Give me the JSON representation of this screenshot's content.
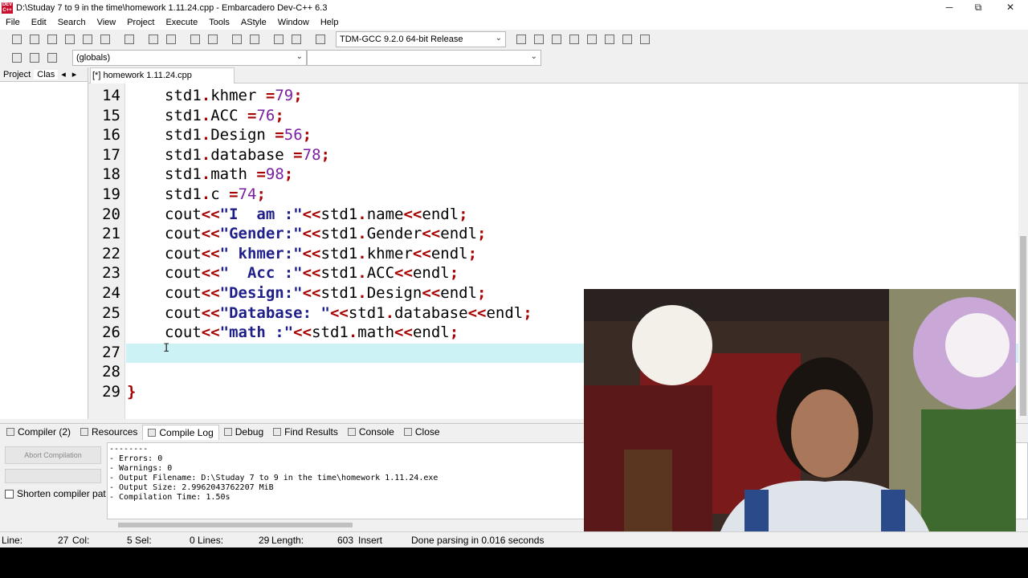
{
  "window": {
    "title": "D:\\Studay 7 to 9 in the time\\homework 1.11.24.cpp - Embarcadero Dev-C++ 6.3",
    "icon_text": "DEV C++",
    "minimize": "─",
    "maximize": "⧉",
    "close": "✕"
  },
  "menu": [
    "File",
    "Edit",
    "Search",
    "View",
    "Project",
    "Execute",
    "Tools",
    "AStyle",
    "Window",
    "Help"
  ],
  "toolbar": {
    "compiler": "TDM-GCC 9.2.0 64-bit Release",
    "icons": [
      "new-file-icon",
      "open-icon",
      "save-icon",
      "save-all-icon",
      "close-file-icon",
      "close-all-icon",
      "print-icon",
      "find-icon",
      "replace-icon",
      "goto-line-icon",
      "toggle-bookmark-icon",
      "undo-icon",
      "redo-icon",
      "indent-icon",
      "unindent-icon",
      "toggle-comment-icon",
      "new-project-icon",
      "project-options-icon",
      "class-browser-icon",
      "insert-icon",
      "compile-icon",
      "stop-icon",
      "chart-icon",
      "debug-icon"
    ]
  },
  "toolbar2": {
    "globals": "(globals)",
    "func": ""
  },
  "side_panel": {
    "tab_project": "Project",
    "tab_classes": "Clas",
    "prev": "◂",
    "next": "▸"
  },
  "editor": {
    "tab_label": "[*] homework 1.11.24.cpp",
    "lines": [
      {
        "num": "14",
        "code": [
          [
            "id",
            "std1"
          ],
          [
            "op",
            "."
          ],
          [
            "id",
            "khmer "
          ],
          [
            "op",
            "="
          ],
          [
            "num",
            "79"
          ],
          [
            "op",
            ";"
          ]
        ]
      },
      {
        "num": "15",
        "code": [
          [
            "id",
            "std1"
          ],
          [
            "op",
            "."
          ],
          [
            "id",
            "ACC "
          ],
          [
            "op",
            "="
          ],
          [
            "num",
            "76"
          ],
          [
            "op",
            ";"
          ]
        ]
      },
      {
        "num": "16",
        "code": [
          [
            "id",
            "std1"
          ],
          [
            "op",
            "."
          ],
          [
            "id",
            "Design "
          ],
          [
            "op",
            "="
          ],
          [
            "num",
            "56"
          ],
          [
            "op",
            ";"
          ]
        ]
      },
      {
        "num": "17",
        "code": [
          [
            "id",
            "std1"
          ],
          [
            "op",
            "."
          ],
          [
            "id",
            "database "
          ],
          [
            "op",
            "="
          ],
          [
            "num",
            "78"
          ],
          [
            "op",
            ";"
          ]
        ]
      },
      {
        "num": "18",
        "code": [
          [
            "id",
            "std1"
          ],
          [
            "op",
            "."
          ],
          [
            "id",
            "math "
          ],
          [
            "op",
            "="
          ],
          [
            "num",
            "98"
          ],
          [
            "op",
            ";"
          ]
        ]
      },
      {
        "num": "19",
        "code": [
          [
            "id",
            "std1"
          ],
          [
            "op",
            "."
          ],
          [
            "id",
            "c "
          ],
          [
            "op",
            "="
          ],
          [
            "num",
            "74"
          ],
          [
            "op",
            ";"
          ]
        ]
      },
      {
        "num": "20",
        "code": [
          [
            "id",
            "cout"
          ],
          [
            "op",
            "<<"
          ],
          [
            "str",
            "\"I  am :\""
          ],
          [
            "op",
            "<<"
          ],
          [
            "id",
            "std1"
          ],
          [
            "op",
            "."
          ],
          [
            "id",
            "name"
          ],
          [
            "op",
            "<<"
          ],
          [
            "id",
            "endl"
          ],
          [
            "op",
            ";"
          ]
        ]
      },
      {
        "num": "21",
        "code": [
          [
            "id",
            "cout"
          ],
          [
            "op",
            "<<"
          ],
          [
            "str",
            "\"Gender:\""
          ],
          [
            "op",
            "<<"
          ],
          [
            "id",
            "std1"
          ],
          [
            "op",
            "."
          ],
          [
            "id",
            "Gender"
          ],
          [
            "op",
            "<<"
          ],
          [
            "id",
            "endl"
          ],
          [
            "op",
            ";"
          ]
        ]
      },
      {
        "num": "22",
        "code": [
          [
            "id",
            "cout"
          ],
          [
            "op",
            "<<"
          ],
          [
            "str",
            "\" khmer:\""
          ],
          [
            "op",
            "<<"
          ],
          [
            "id",
            "std1"
          ],
          [
            "op",
            "."
          ],
          [
            "id",
            "khmer"
          ],
          [
            "op",
            "<<"
          ],
          [
            "id",
            "endl"
          ],
          [
            "op",
            ";"
          ]
        ]
      },
      {
        "num": "23",
        "code": [
          [
            "id",
            "cout"
          ],
          [
            "op",
            "<<"
          ],
          [
            "str",
            "\"  Acc :\""
          ],
          [
            "op",
            "<<"
          ],
          [
            "id",
            "std1"
          ],
          [
            "op",
            "."
          ],
          [
            "id",
            "ACC"
          ],
          [
            "op",
            "<<"
          ],
          [
            "id",
            "endl"
          ],
          [
            "op",
            ";"
          ]
        ]
      },
      {
        "num": "24",
        "code": [
          [
            "id",
            "cout"
          ],
          [
            "op",
            "<<"
          ],
          [
            "str",
            "\"Design:\""
          ],
          [
            "op",
            "<<"
          ],
          [
            "id",
            "std1"
          ],
          [
            "op",
            "."
          ],
          [
            "id",
            "Design"
          ],
          [
            "op",
            "<<"
          ],
          [
            "id",
            "endl"
          ],
          [
            "op",
            ";"
          ]
        ]
      },
      {
        "num": "25",
        "code": [
          [
            "id",
            "cout"
          ],
          [
            "op",
            "<<"
          ],
          [
            "str",
            "\"Database: \""
          ],
          [
            "op",
            "<<"
          ],
          [
            "id",
            "std1"
          ],
          [
            "op",
            "."
          ],
          [
            "id",
            "database"
          ],
          [
            "op",
            "<<"
          ],
          [
            "id",
            "endl"
          ],
          [
            "op",
            ";"
          ]
        ]
      },
      {
        "num": "26",
        "code": [
          [
            "id",
            "cout"
          ],
          [
            "op",
            "<<"
          ],
          [
            "str",
            "\"math :\""
          ],
          [
            "op",
            "<<"
          ],
          [
            "id",
            "std1"
          ],
          [
            "op",
            "."
          ],
          [
            "id",
            "math"
          ],
          [
            "op",
            "<<"
          ],
          [
            "id",
            "endl"
          ],
          [
            "op",
            ";"
          ]
        ]
      },
      {
        "num": "27",
        "code": []
      },
      {
        "num": "28",
        "code": []
      },
      {
        "num": "29",
        "code": [
          [
            "op",
            "}"
          ]
        ]
      }
    ],
    "indent_lines": 13
  },
  "bottom_tabs": [
    {
      "label": "Compiler (2)",
      "icon": "compiler-icon",
      "active": false
    },
    {
      "label": "Resources",
      "icon": "resources-icon",
      "active": false
    },
    {
      "label": "Compile Log",
      "icon": "compile-log-icon",
      "active": true
    },
    {
      "label": "Debug",
      "icon": "debug-icon",
      "active": false
    },
    {
      "label": "Find Results",
      "icon": "find-results-icon",
      "active": false
    },
    {
      "label": "Console",
      "icon": "console-icon",
      "active": false
    },
    {
      "label": "Close",
      "icon": "close-panel-icon",
      "active": false
    }
  ],
  "compile_panel": {
    "abort": "Abort Compilation",
    "shorten": "Shorten compiler pat"
  },
  "compile_log": [
    "--------",
    "- Errors: 0",
    "- Warnings: 0",
    "- Output Filename: D:\\Studay 7 to 9 in the time\\homework 1.11.24.exe",
    "- Output Size: 2.9962043762207 MiB",
    "- Compilation Time: 1.50s"
  ],
  "status": {
    "line_label": "Line:",
    "line": "27",
    "col_label": "Col:",
    "col": "5",
    "sel_label": "Sel:",
    "sel": "0",
    "lines_label": "Lines:",
    "lines": "29",
    "length_label": "Length:",
    "length": "603",
    "mode": "Insert",
    "message": "Done parsing in 0.016 seconds"
  }
}
